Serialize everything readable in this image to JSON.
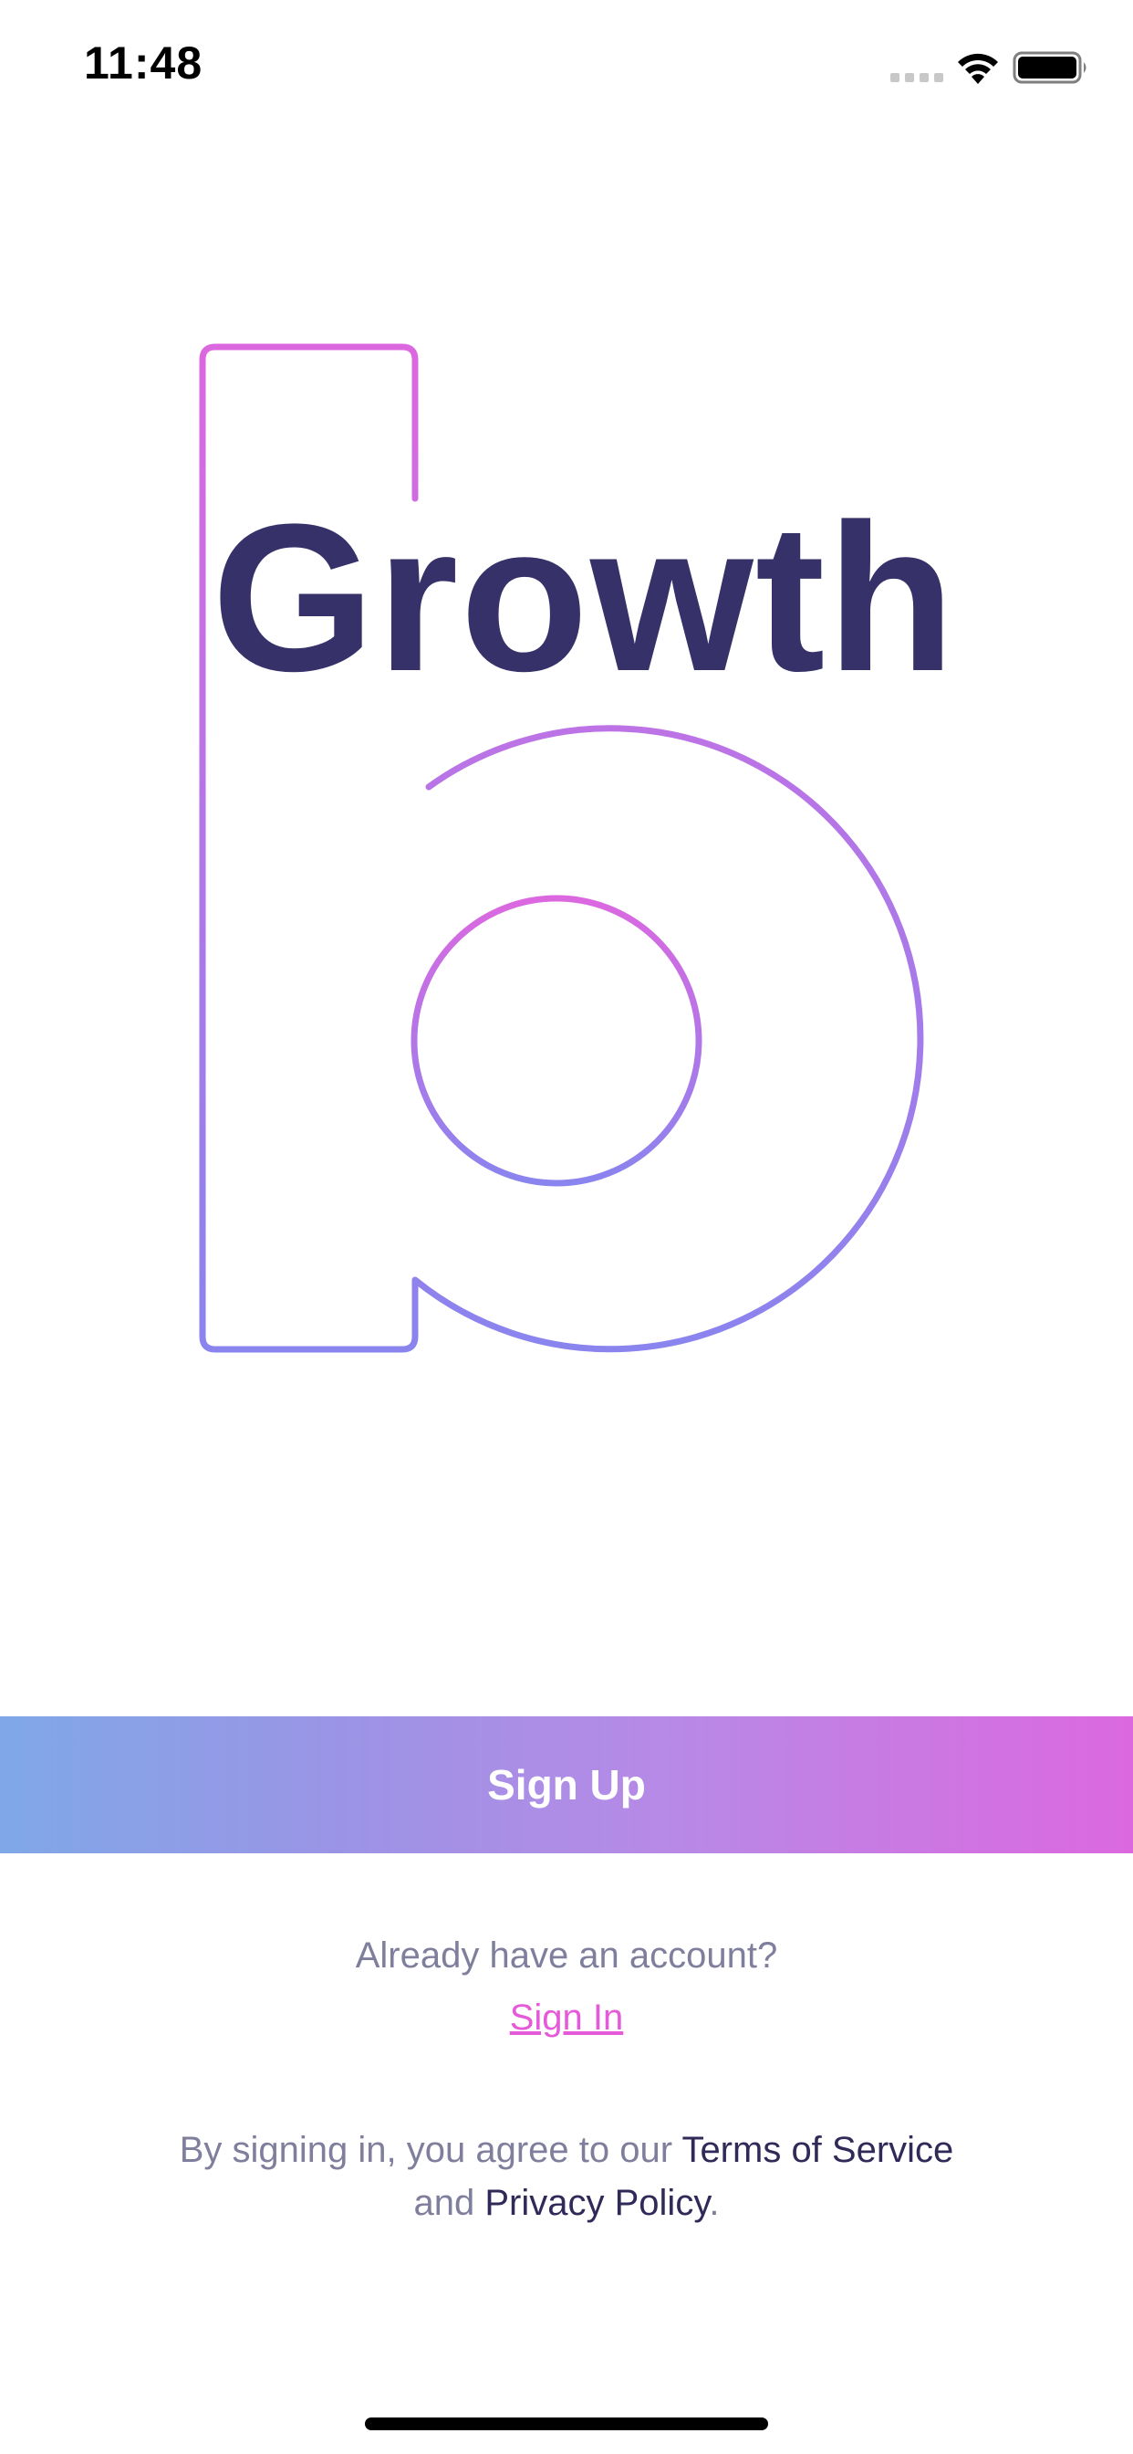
{
  "status_bar": {
    "time": "11:48",
    "signal_icon": "signal-dots-icon",
    "wifi_icon": "wifi-icon",
    "battery_icon": "battery-icon"
  },
  "logo": {
    "wordmark": "Growth",
    "symbol_icon": "b-outline-logo",
    "gradient": [
      "#dc68e0",
      "#8a84ee"
    ],
    "wordmark_color": "#37316a"
  },
  "actions": {
    "sign_up_label": "Sign Up",
    "account_prompt": "Already have an account?",
    "sign_in_label": "Sign In"
  },
  "legal": {
    "prefix": "By signing in, you agree to our ",
    "terms_label": "Terms of Service",
    "middle": "and ",
    "privacy_label": "Privacy Policy",
    "suffix": "."
  },
  "colors": {
    "button_gradient": [
      "#7fa8e8",
      "#9b94e6",
      "#b889e6",
      "#dc68e0"
    ],
    "link_pink": "#e45ad8",
    "muted_text": "#7f7f9d",
    "dark_link": "#2f2a58"
  }
}
